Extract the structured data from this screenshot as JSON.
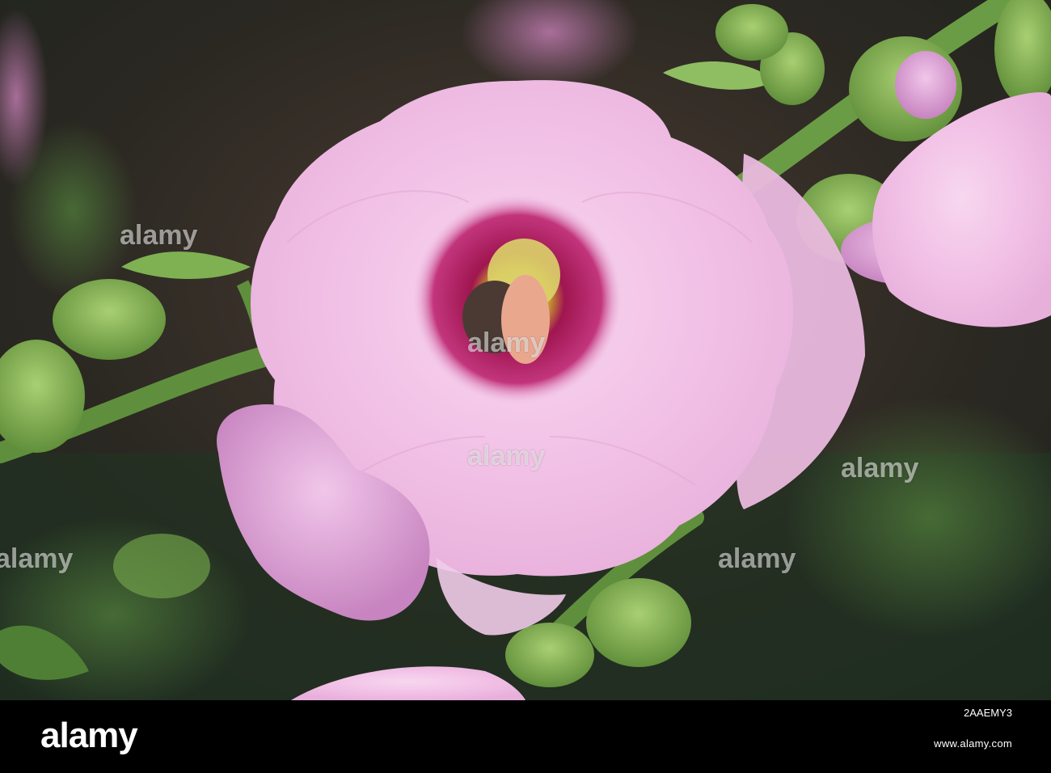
{
  "watermark": {
    "text": "alamy"
  },
  "footer": {
    "logo": "alamy",
    "image_id": "2AAEMY3",
    "url": "www.alamy.com"
  },
  "colors": {
    "petal": "#f3c6e8",
    "petal_shadow": "#d7a0cf",
    "eye": "#a0124f",
    "leaf": "#5f8f3d",
    "background": "#2d2a25"
  }
}
